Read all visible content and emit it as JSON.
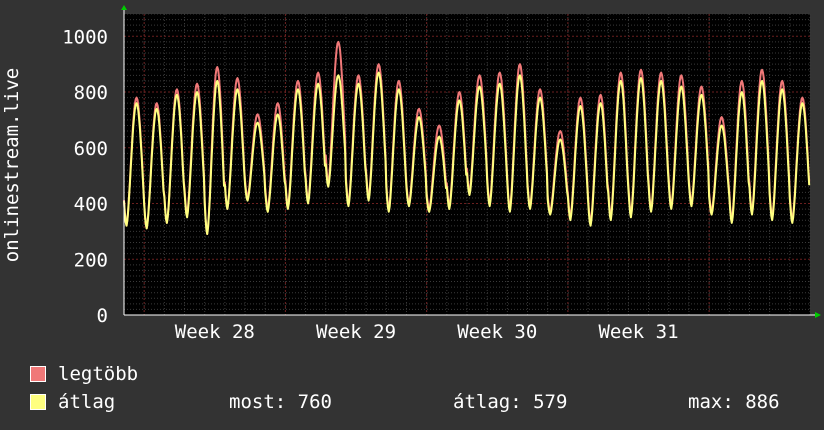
{
  "chart_data": {
    "type": "line",
    "ylabel": "onlinestream.live",
    "ylim": [
      0,
      1080
    ],
    "yticks": [
      0,
      200,
      400,
      600,
      800,
      1000
    ],
    "week_labels": [
      "Week 28",
      "Week 29",
      "Week 30",
      "Week 31"
    ],
    "grid": true,
    "background": "#000000",
    "grid_color": "#6b1f1f",
    "x": [
      "Week 27 day 7",
      "Week 28 day 1",
      "Week 28 day 2",
      "Week 28 day 3",
      "Week 28 day 4",
      "Week 28 day 5",
      "Week 28 day 6",
      "Week 28 day 7",
      "Week 29 day 1",
      "Week 29 day 2",
      "Week 29 day 3",
      "Week 29 day 4",
      "Week 29 day 5",
      "Week 29 day 6",
      "Week 29 day 7",
      "Week 30 day 1",
      "Week 30 day 2",
      "Week 30 day 3",
      "Week 30 day 4",
      "Week 30 day 5",
      "Week 30 day 6",
      "Week 30 day 7",
      "Week 31 day 1",
      "Week 31 day 2",
      "Week 31 day 3",
      "Week 31 day 4",
      "Week 31 day 5",
      "Week 31 day 6",
      "Week 31 day 7",
      "Week 32 day 1",
      "Week 32 day 2",
      "Week 32 day 3",
      "Week 32 day 4",
      "Week 32 day 5"
    ],
    "series": [
      {
        "name": "legtöbb",
        "color": "#f07878",
        "daily_max": [
          780,
          760,
          810,
          830,
          890,
          850,
          720,
          760,
          840,
          870,
          980,
          860,
          900,
          840,
          740,
          680,
          800,
          860,
          870,
          900,
          810,
          660,
          780,
          790,
          870,
          880,
          870,
          860,
          820,
          710,
          840,
          880,
          840,
          780
        ],
        "daily_min": [
          320,
          310,
          330,
          360,
          290,
          380,
          420,
          380,
          390,
          410,
          470,
          400,
          420,
          380,
          400,
          380,
          390,
          440,
          400,
          380,
          390,
          370,
          350,
          330,
          350,
          360,
          380,
          390,
          400,
          370,
          340,
          370,
          350,
          340
        ]
      },
      {
        "name": "átlag",
        "color": "#ffff80",
        "daily_max": [
          760,
          740,
          790,
          800,
          840,
          810,
          690,
          720,
          810,
          830,
          860,
          830,
          870,
          810,
          710,
          640,
          770,
          820,
          830,
          860,
          780,
          630,
          750,
          760,
          840,
          850,
          840,
          820,
          790,
          680,
          800,
          840,
          810,
          760
        ],
        "daily_min": [
          320,
          310,
          330,
          350,
          290,
          380,
          410,
          370,
          380,
          400,
          460,
          390,
          410,
          370,
          390,
          370,
          380,
          430,
          390,
          370,
          380,
          360,
          340,
          320,
          340,
          350,
          370,
          380,
          390,
          360,
          330,
          360,
          340,
          330
        ]
      }
    ]
  },
  "legend": {
    "max_label": "legtöbb",
    "avg_label": "átlag",
    "max_color": "#f07878",
    "avg_color": "#ffff80"
  },
  "stats": {
    "current": "most: 760",
    "average": "átlag: 579",
    "maximum": "max: 886"
  }
}
